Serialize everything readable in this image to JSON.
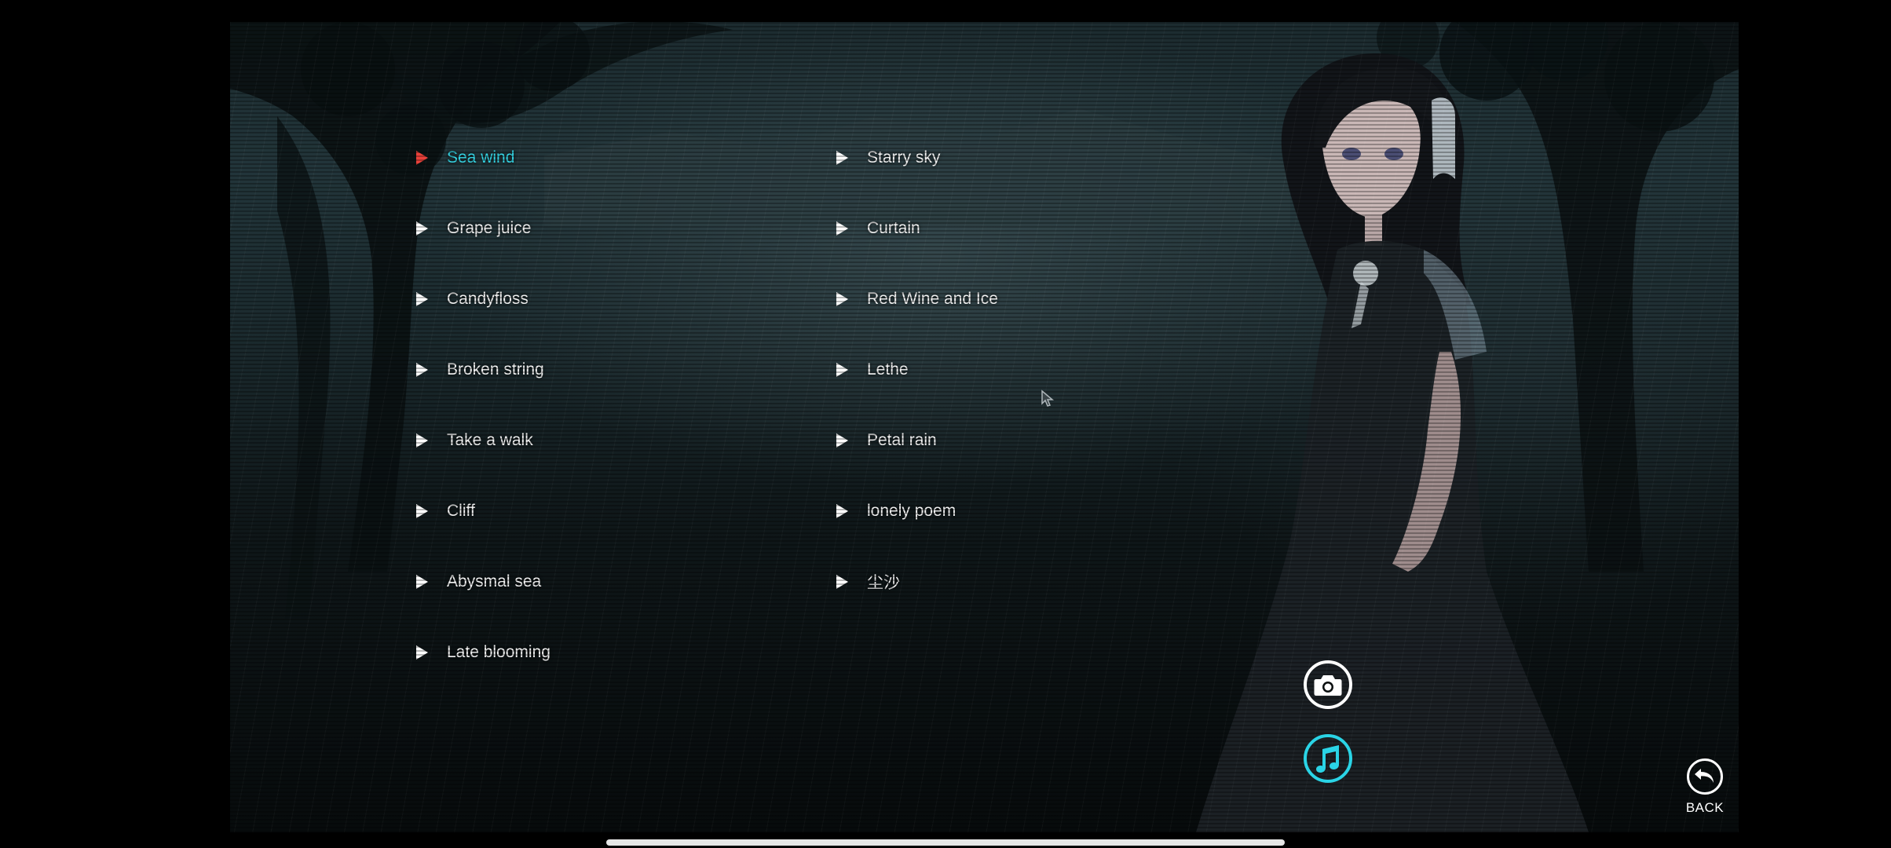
{
  "tracks_left": [
    {
      "label": "Sea wind",
      "selected": true
    },
    {
      "label": "Grape juice",
      "selected": false
    },
    {
      "label": "Candyfloss",
      "selected": false
    },
    {
      "label": "Broken string",
      "selected": false
    },
    {
      "label": "Take a walk",
      "selected": false
    },
    {
      "label": "Cliff",
      "selected": false
    },
    {
      "label": "Abysmal sea",
      "selected": false
    },
    {
      "label": "Late blooming",
      "selected": false
    }
  ],
  "tracks_right": [
    {
      "label": "Starry sky",
      "selected": false
    },
    {
      "label": "Curtain",
      "selected": false
    },
    {
      "label": "Red Wine and Ice",
      "selected": false
    },
    {
      "label": "Lethe",
      "selected": false
    },
    {
      "label": "Petal rain",
      "selected": false
    },
    {
      "label": "lonely poem",
      "selected": false
    },
    {
      "label": "尘沙",
      "selected": false
    }
  ],
  "buttons": {
    "camera_icon": "camera-icon",
    "music_icon": "music-note-icon",
    "back_label": "BACK",
    "back_icon": "undo-arrow-icon"
  },
  "colors": {
    "selected_text": "#35d6e6",
    "selected_marker": "#e8413a",
    "music_button_accent": "#2ad4e6",
    "default_text": "#f2f2f2"
  }
}
